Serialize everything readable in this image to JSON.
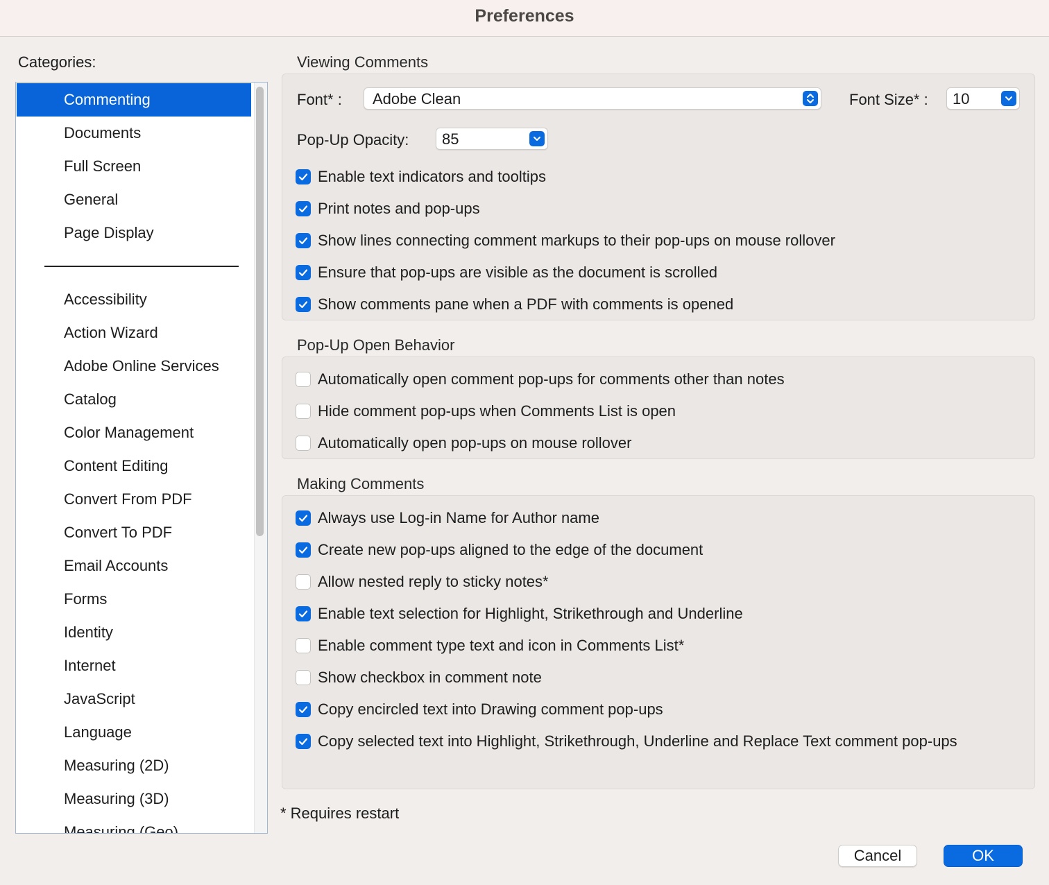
{
  "window": {
    "title": "Preferences"
  },
  "sidebar": {
    "label": "Categories:",
    "items_top": [
      {
        "label": "Commenting",
        "selected": true
      },
      {
        "label": "Documents"
      },
      {
        "label": "Full Screen"
      },
      {
        "label": "General"
      },
      {
        "label": "Page Display"
      }
    ],
    "items_bottom": [
      {
        "label": "Accessibility"
      },
      {
        "label": "Action Wizard"
      },
      {
        "label": "Adobe Online Services"
      },
      {
        "label": "Catalog"
      },
      {
        "label": "Color Management"
      },
      {
        "label": "Content Editing"
      },
      {
        "label": "Convert From PDF"
      },
      {
        "label": "Convert To PDF"
      },
      {
        "label": "Email Accounts"
      },
      {
        "label": "Forms"
      },
      {
        "label": "Identity"
      },
      {
        "label": "Internet"
      },
      {
        "label": "JavaScript"
      },
      {
        "label": "Language"
      },
      {
        "label": "Measuring (2D)"
      },
      {
        "label": "Measuring (3D)"
      },
      {
        "label": "Measuring (Geo)"
      }
    ]
  },
  "viewing": {
    "heading": "Viewing Comments",
    "font_label": "Font* :",
    "font_value": "Adobe Clean",
    "font_size_label": "Font Size* :",
    "font_size_value": "10",
    "opacity_label": "Pop-Up Opacity:",
    "opacity_value": "85",
    "options": [
      {
        "label": "Enable text indicators and tooltips",
        "checked": true
      },
      {
        "label": "Print notes and pop-ups",
        "checked": true
      },
      {
        "label": "Show lines connecting comment markups to their pop-ups on mouse rollover",
        "checked": true
      },
      {
        "label": "Ensure that pop-ups are visible as the document is scrolled",
        "checked": true
      },
      {
        "label": "Show comments pane when a PDF with comments is opened",
        "checked": true
      }
    ]
  },
  "popup_behavior": {
    "heading": "Pop-Up Open Behavior",
    "options": [
      {
        "label": "Automatically open comment pop-ups for comments other than notes",
        "checked": false
      },
      {
        "label": "Hide comment pop-ups when Comments List is open",
        "checked": false
      },
      {
        "label": "Automatically open pop-ups on mouse rollover",
        "checked": false
      }
    ]
  },
  "making": {
    "heading": "Making Comments",
    "options": [
      {
        "label": "Always use Log-in Name for Author name",
        "checked": true
      },
      {
        "label": "Create new pop-ups aligned to the edge of the document",
        "checked": true
      },
      {
        "label": "Allow nested reply to sticky notes*",
        "checked": false
      },
      {
        "label": "Enable text selection for Highlight, Strikethrough and Underline",
        "checked": true
      },
      {
        "label": "Enable comment type text and icon in Comments List*",
        "checked": false
      },
      {
        "label": "Show checkbox in comment note",
        "checked": false
      },
      {
        "label": "Copy encircled text into Drawing comment pop-ups",
        "checked": true
      },
      {
        "label": "Copy selected text into Highlight, Strikethrough, Underline and Replace Text comment pop-ups",
        "checked": true
      }
    ]
  },
  "footnote": "* Requires restart",
  "buttons": {
    "cancel": "Cancel",
    "ok": "OK"
  },
  "colors": {
    "accent": "#0a6be0",
    "selection": "#0864d8"
  }
}
